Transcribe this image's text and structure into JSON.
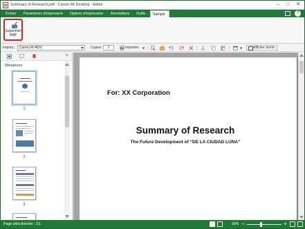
{
  "window": {
    "title": "Summary of Research.pdf - Canon iW Desktop - Editor",
    "minimize": "–",
    "maximize": "□",
    "close": "✕"
  },
  "tabs": [
    {
      "label": "Fichier"
    },
    {
      "label": "Paramètres d'impression"
    },
    {
      "label": "Options d'impression"
    },
    {
      "label": "Annotations"
    },
    {
      "label": "Outils"
    },
    {
      "label": "Sample"
    }
  ],
  "help_label": "?",
  "ribbon": {
    "button_label": "Supprimer MdP"
  },
  "toolbar": {
    "printer_label": "Imprim.:",
    "printer_value": "Canon iR-ADV",
    "copies_label": "Copies",
    "copies_value": "1",
    "print_label": "Imprimer",
    "show_annotations": "Afficher annot."
  },
  "thumbnails": {
    "title": "Miniatures",
    "close": "×",
    "pages": [
      {
        "number": "1"
      },
      {
        "number": "2"
      },
      {
        "number": "3"
      }
    ]
  },
  "document": {
    "for_line": "For: XX Corporation",
    "title": "Summary of Research",
    "subtitle": "The Future Development of “DE LA CIUDAD LUNA”"
  },
  "status": {
    "text": "Page sélectionnée : /11",
    "zoom": "90%",
    "zoom_minus": "−",
    "zoom_plus": "+"
  },
  "colors": {
    "accent": "#1e7a36",
    "highlight": "#e0201e"
  }
}
